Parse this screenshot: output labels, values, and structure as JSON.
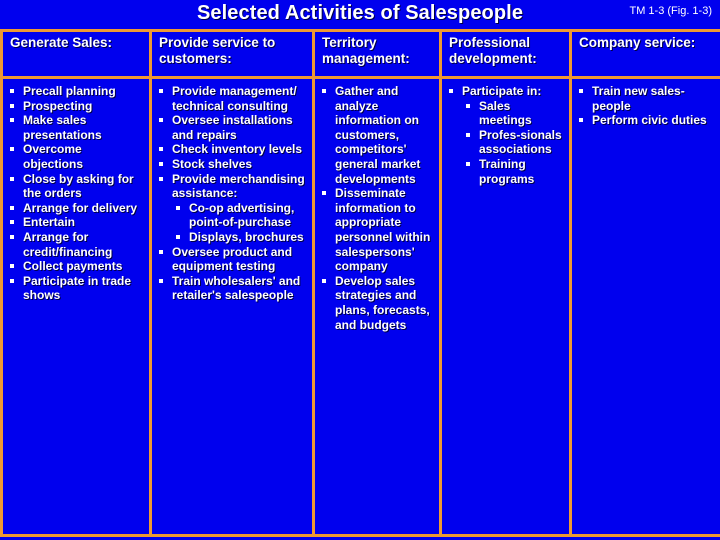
{
  "slide": {
    "title": "Selected Activities of Salespeople",
    "reference": "TM 1-3 (Fig. 1-3)",
    "colors": {
      "background": "#0000EE",
      "border": "#EE9933",
      "text": "#FFFFFF"
    }
  },
  "table": {
    "columns": [
      {
        "header": "Generate Sales:",
        "items": [
          {
            "text": "Precall planning"
          },
          {
            "text": "Prospecting"
          },
          {
            "text": "Make sales presentations"
          },
          {
            "text": "Overcome objections"
          },
          {
            "text": "Close by asking for the orders"
          },
          {
            "text": "Arrange for delivery"
          },
          {
            "text": "Entertain"
          },
          {
            "text": "Arrange for credit/financing"
          },
          {
            "text": "Collect payments"
          },
          {
            "text": "Participate in trade shows"
          }
        ]
      },
      {
        "header": "Provide service to customers:",
        "items": [
          {
            "text": "Provide management/ technical consulting"
          },
          {
            "text": "Oversee installations and repairs"
          },
          {
            "text": "Check inventory levels"
          },
          {
            "text": "Stock shelves"
          },
          {
            "text": "Provide merchandising assistance:",
            "subitems": [
              {
                "text": "Co-op advertising, point-of-purchase"
              },
              {
                "text": "Displays, brochures"
              }
            ]
          },
          {
            "text": "Oversee product and equipment testing"
          },
          {
            "text": "Train wholesalers' and retailer's salespeople"
          }
        ]
      },
      {
        "header": "Territory management:",
        "items": [
          {
            "text": "Gather and analyze information on customers, competitors' general market developments"
          },
          {
            "text": "Disseminate information to appropriate personnel within salespersons' company"
          },
          {
            "text": "Develop sales strategies and plans, forecasts, and budgets"
          }
        ]
      },
      {
        "header": "Professional development:",
        "items": [
          {
            "text": "Participate in:",
            "subitems": [
              {
                "text": "Sales meetings"
              },
              {
                "text": "Profes-sionals associations"
              },
              {
                "text": "Training programs"
              }
            ]
          }
        ]
      },
      {
        "header": "Company service:",
        "items": [
          {
            "text": "Train new sales-people"
          },
          {
            "text": "Perform civic duties"
          }
        ]
      }
    ]
  }
}
